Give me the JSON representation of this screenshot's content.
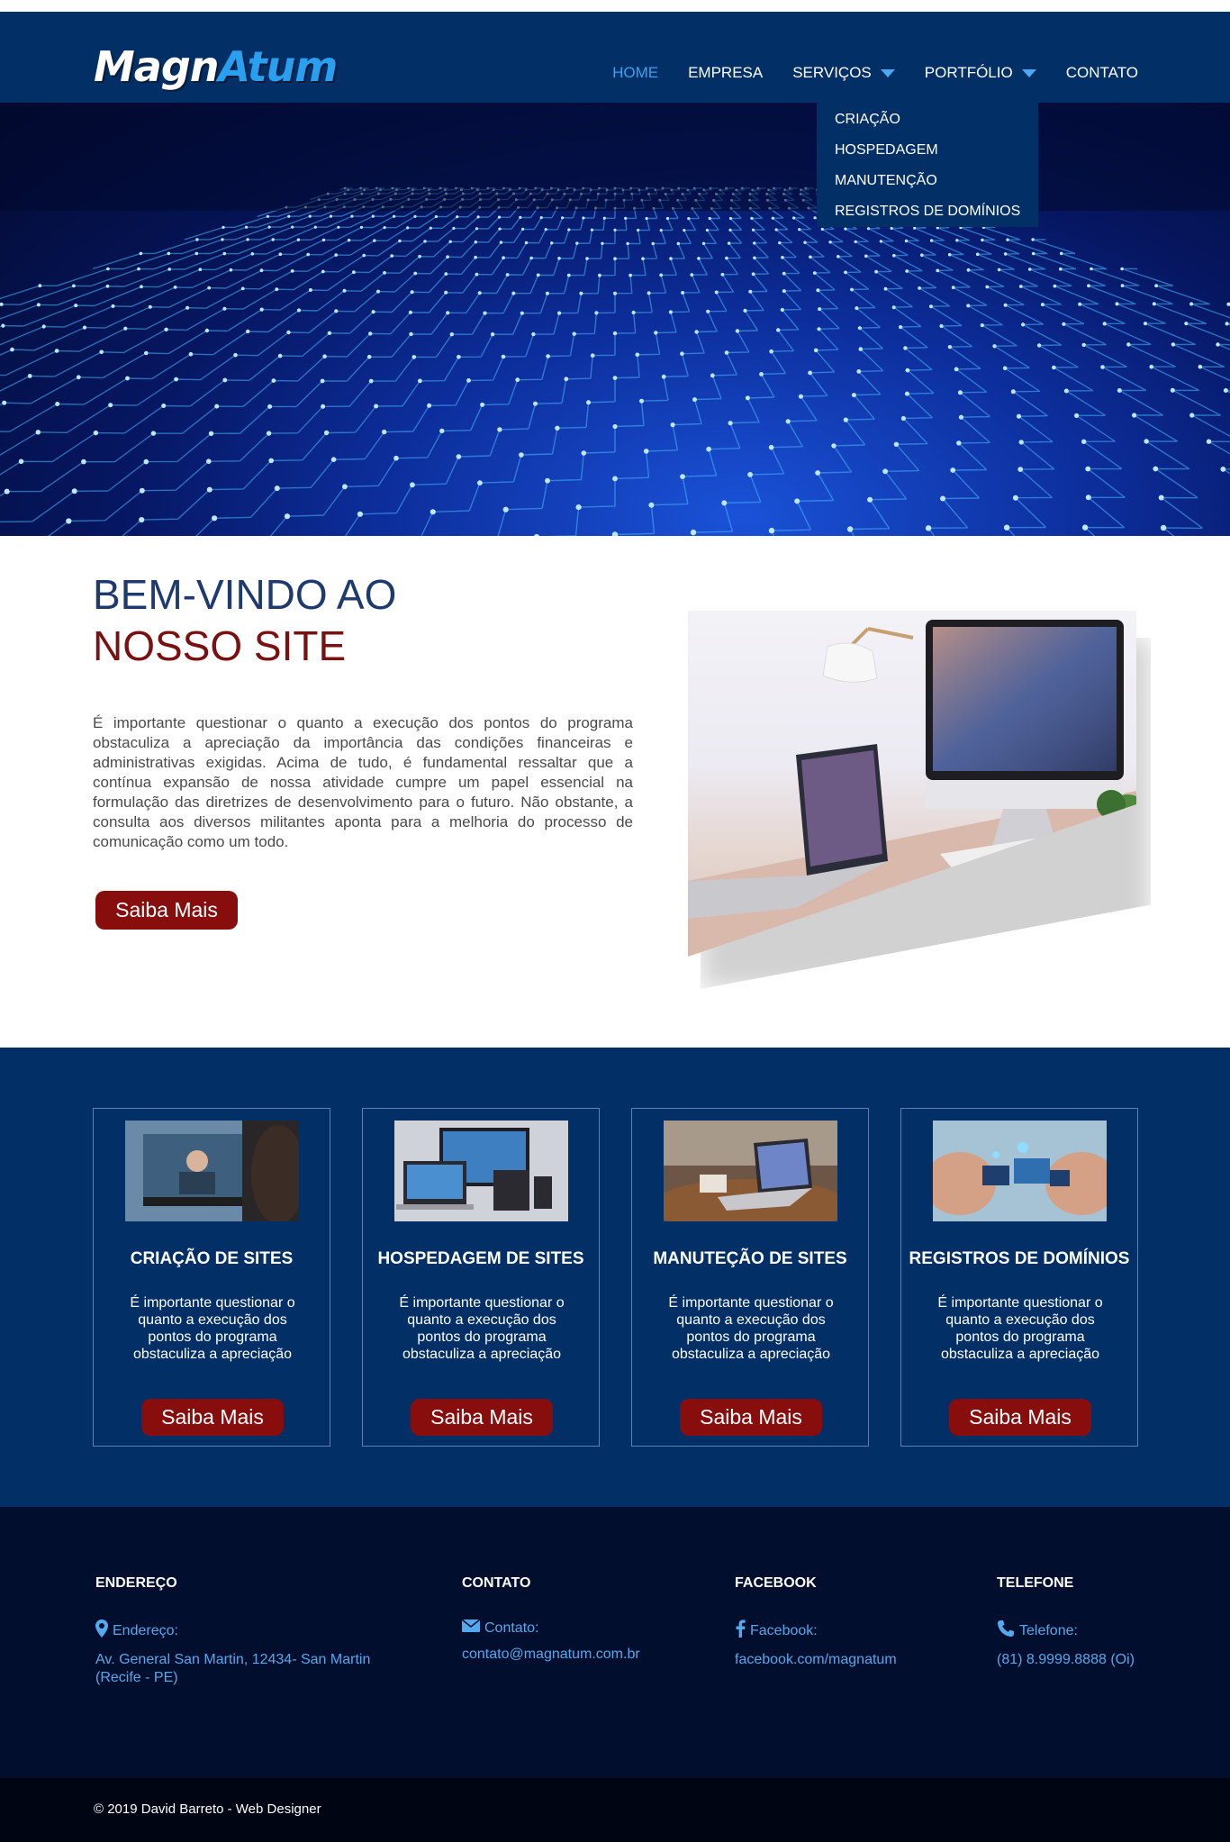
{
  "brand": {
    "logo_part1": "Magn",
    "logo_part2": "Atum"
  },
  "nav": {
    "items": [
      {
        "label": "HOME",
        "active": true
      },
      {
        "label": "EMPRESA"
      },
      {
        "label": "SERVIÇOS",
        "dropdown": true
      },
      {
        "label": "PORTFÓLIO",
        "dropdown": true
      },
      {
        "label": "CONTATO"
      }
    ],
    "services_menu": [
      "CRIAÇÃO",
      "HOSPEDAGEM",
      "MANUTENÇÃO",
      "REGISTROS DE DOMÍNIOS"
    ]
  },
  "welcome": {
    "title_line1": "BEM-VINDO AO",
    "title_line2": "NOSSO SITE",
    "text": "É importante questionar o quanto a execução dos pontos do programa obstaculiza a apreciação da importância das condições financeiras e administrativas exigidas. Acima de tudo, é fundamental ressaltar que a contínua expansão de nossa atividade cumpre um papel essencial na formulação das diretrizes de desenvolvimento para o futuro. Não obstante, a consulta aos diversos militantes aponta para a melhoria do processo de comunicação como um todo.",
    "button": "Saiba Mais"
  },
  "services": [
    {
      "title": "CRIAÇÃO DE SITES",
      "text": "É importante questionar o quanto a execução dos pontos do programa obstaculiza a apreciação",
      "button": "Saiba Mais"
    },
    {
      "title": "HOSPEDAGEM DE SITES",
      "text": "É importante questionar o quanto a execução dos pontos do programa obstaculiza a apreciação",
      "button": "Saiba Mais"
    },
    {
      "title": "MANUTEÇÃO DE SITES",
      "text": "É importante questionar o quanto a execução dos pontos do programa obstaculiza a apreciação",
      "button": "Saiba Mais"
    },
    {
      "title": "REGISTROS DE DOMÍNIOS",
      "text": "É importante questionar o quanto a execução dos pontos do programa obstaculiza a apreciação",
      "button": "Saiba Mais"
    }
  ],
  "footer": {
    "address": {
      "heading": "ENDEREÇO",
      "label": "Endereço:",
      "value": "Av. General San Martin, 12434- San Martin (Recife - PE)",
      "icon": "map-pin-icon"
    },
    "contact": {
      "heading": "CONTATO",
      "label": "Contato:",
      "value": "contato@magnatum.com.br",
      "icon": "envelope-icon"
    },
    "facebook": {
      "heading": "FACEBOOK",
      "label": "Facebook:",
      "value": "facebook.com/magnatum",
      "icon": "facebook-icon"
    },
    "phone": {
      "heading": "TELEFONE",
      "label": "Telefone:",
      "value": "(81) 8.9999.8888 (Oi)",
      "icon": "phone-icon"
    }
  },
  "copyright": "© 2019 David Barreto - Web Designer",
  "colors": {
    "navy": "#022f66",
    "accent_blue": "#36a4f2",
    "brand_red": "#880d0d",
    "footer_dark": "#020e2e"
  }
}
